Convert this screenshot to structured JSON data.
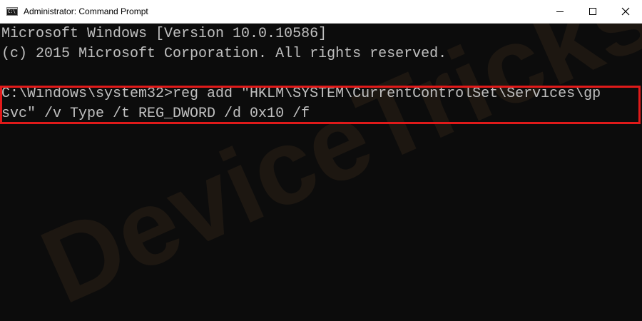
{
  "window": {
    "title": "Administrator: Command Prompt",
    "icon": "cmd-icon",
    "icon_glyph": "C:\\"
  },
  "console": {
    "lines": [
      "Microsoft Windows [Version 10.0.10586]",
      "(c) 2015 Microsoft Corporation. All rights reserved.",
      "C:\\Windows\\system32>reg add \"HKLM\\SYSTEM\\CurrentControlSet\\Services\\gp",
      "svc\" /v Type /t REG_DWORD /d 0x10 /f"
    ],
    "text_color": "#c0c0c0",
    "background_color": "#0c0c0c"
  },
  "highlight": {
    "color": "#e01a1a"
  },
  "watermark": {
    "text": "DeviceTricks"
  }
}
